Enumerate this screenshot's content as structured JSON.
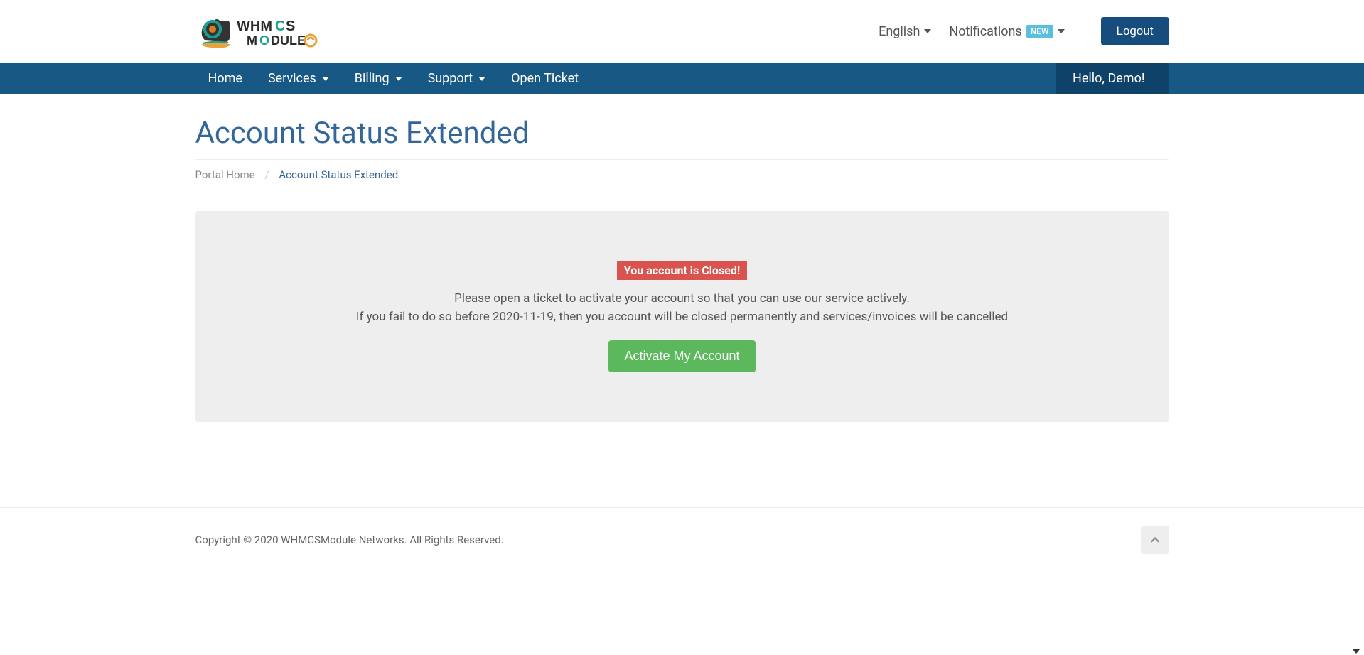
{
  "topbar": {
    "language": "English",
    "notifications_label": "Notifications",
    "notifications_badge": "NEW",
    "logout": "Logout"
  },
  "nav": {
    "items": [
      "Home",
      "Services",
      "Billing",
      "Support",
      "Open Ticket"
    ],
    "hello": "Hello, Demo!"
  },
  "page": {
    "title": "Account Status Extended"
  },
  "breadcrumb": {
    "home": "Portal Home",
    "sep": "/",
    "current": "Account Status Extended"
  },
  "well": {
    "status": "You account is Closed!",
    "line1": "Please open a ticket to activate your account so that you can use our service actively.",
    "line2": "If you fail to do so before 2020-11-19, then you account will be closed permanently and services/invoices will be cancelled",
    "button": "Activate My Account"
  },
  "footer": {
    "copyright": "Copyright © 2020 WHMCSModule Networks. All Rights Reserved."
  }
}
